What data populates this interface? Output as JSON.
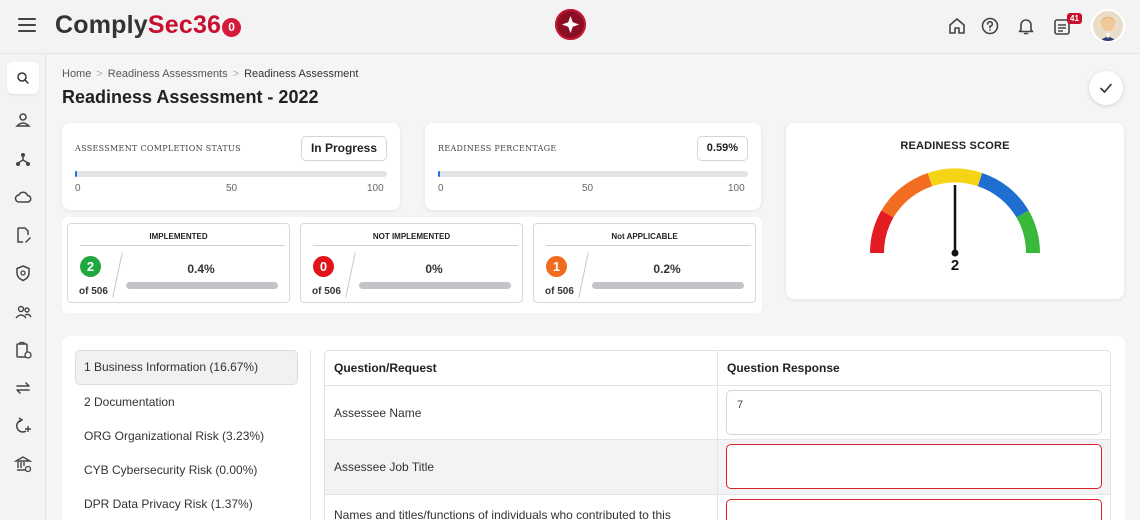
{
  "app": {
    "brand_prefix": "Comply",
    "brand_accent": "Sec36",
    "brand_ring": "0",
    "notification_count": "41"
  },
  "colors": {
    "brand": "#c8102e",
    "accent_blue": "#1a73e8",
    "green": "#1fa83f",
    "red": "#e0131b",
    "orange": "#f26a1b",
    "error_border": "#d9222b"
  },
  "icons": {
    "top": [
      "home-icon",
      "help-icon",
      "bell-icon",
      "notifications-list-icon"
    ],
    "sidebar": [
      "search-icon",
      "user-icon",
      "network-icon",
      "cloud-icon",
      "document-edit-icon",
      "shield-icon",
      "users-icon",
      "clipboard-icon",
      "transfer-icon",
      "refresh-add-icon",
      "bank-settings-icon"
    ]
  },
  "breadcrumb": {
    "items": [
      "Home",
      "Readiness Assessments",
      "Readiness Assessment"
    ]
  },
  "page": {
    "title": "Readiness Assessment - 2022"
  },
  "completion": {
    "label": "ASSESSMENT COMPLETION STATUS",
    "status": "In Progress",
    "progress_fraction": 0.005,
    "ticks": [
      "0",
      "50",
      "100"
    ]
  },
  "readiness_pct": {
    "label": "READINESS PERCENTAGE",
    "value": "0.59%",
    "progress_fraction": 0.0059,
    "ticks": [
      "0",
      "50",
      "100"
    ]
  },
  "stats": [
    {
      "title": "IMPLEMENTED",
      "count": "2",
      "of": "of 506",
      "pct": "0.4%",
      "color": "#1fa83f"
    },
    {
      "title": "NOT IMPLEMENTED",
      "count": "0",
      "of": "of 506",
      "pct": "0%",
      "color": "#e0131b"
    },
    {
      "title": "Not APPLICABLE",
      "count": "1",
      "of": "of 506",
      "pct": "0.2%",
      "color": "#f26a1b"
    }
  ],
  "readiness_score": {
    "title": "READINESS SCORE",
    "value": "2",
    "segments": [
      "#e31b23",
      "#f26d1f",
      "#f4d415",
      "#1f6fd1",
      "#3ab83a"
    ]
  },
  "sections": [
    "1 Business Information (16.67%)",
    "2 Documentation",
    "ORG Organizational Risk (3.23%)",
    "CYB Cybersecurity Risk (0.00%)",
    "DPR Data Privacy Risk (1.37%)"
  ],
  "table": {
    "col_question": "Question/Request",
    "col_response": "Question Response",
    "rows": [
      {
        "question": "Assessee Name",
        "response": "7"
      },
      {
        "question": "Assessee Job Title",
        "response": ""
      },
      {
        "question": "Names and titles/functions of individuals who contributed to this",
        "response": ""
      }
    ]
  }
}
